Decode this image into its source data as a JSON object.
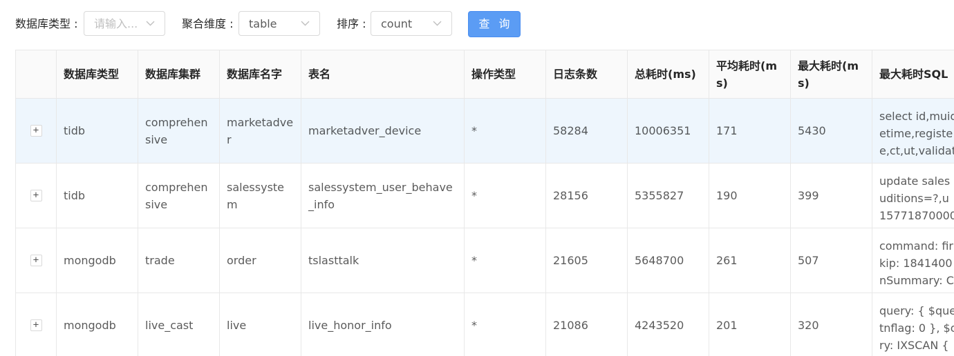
{
  "filters": {
    "db_type_label": "数据库类型 :",
    "db_type_placeholder": "请输入...",
    "dimension_label": "聚合维度 :",
    "dimension_value": "table",
    "sort_label": "排序 :",
    "sort_value": "count",
    "query_button": "查 询"
  },
  "table": {
    "headers": {
      "db_type": "数据库类型",
      "db_cluster": "数据库集群",
      "db_name": "数据库名字",
      "table_name": "表名",
      "op_type": "操作类型",
      "log_count": "日志条数",
      "total_ms": "总耗时(ms)",
      "avg_ms": "平均耗时(ms)",
      "max_ms": "最大耗时(ms)",
      "max_sql": "最大耗时SQL"
    },
    "rows": [
      {
        "expand": "+",
        "db_type": "tidb",
        "db_cluster": "comprehensive",
        "db_name": "marketadver",
        "table_name": "marketadver_device",
        "op_type": "*",
        "log_count": "58284",
        "total_ms": "10006351",
        "avg_ms": "171",
        "max_ms": "5430",
        "max_sql": [
          "select id,muid",
          "etime,registe",
          "e,ct,ut,validat"
        ]
      },
      {
        "expand": "+",
        "db_type": "tidb",
        "db_cluster": "comprehensive",
        "db_name": "salessystem",
        "table_name": "salessystem_user_behave_info",
        "op_type": "*",
        "log_count": "28156",
        "total_ms": "5355827",
        "avg_ms": "190",
        "max_ms": "399",
        "max_sql": [
          "update sales",
          "uditions=?,u",
          "15771870000"
        ]
      },
      {
        "expand": "+",
        "db_type": "mongodb",
        "db_cluster": "trade",
        "db_name": "order",
        "table_name": "tslasttalk",
        "op_type": "*",
        "log_count": "21605",
        "total_ms": "5648700",
        "avg_ms": "261",
        "max_ms": "507",
        "max_sql": [
          "command: fir",
          "kip: 1841400",
          "nSummary: C"
        ]
      },
      {
        "expand": "+",
        "db_type": "mongodb",
        "db_cluster": "live_cast",
        "db_name": "live",
        "table_name": "live_honor_info",
        "op_type": "*",
        "log_count": "21086",
        "total_ms": "4243520",
        "avg_ms": "201",
        "max_ms": "320",
        "max_sql": [
          "query: { $que",
          "tnflag: 0 }, $o",
          "ry: IXSCAN {"
        ]
      }
    ]
  },
  "colors": {
    "primary": "#5b9cf4",
    "row_highlight": "#eef6fd",
    "header_bg": "#fafafa",
    "border": "#e8e8e8"
  },
  "icons": {
    "select_arrow": "chevron-down-icon",
    "row_expand": "plus-icon"
  }
}
